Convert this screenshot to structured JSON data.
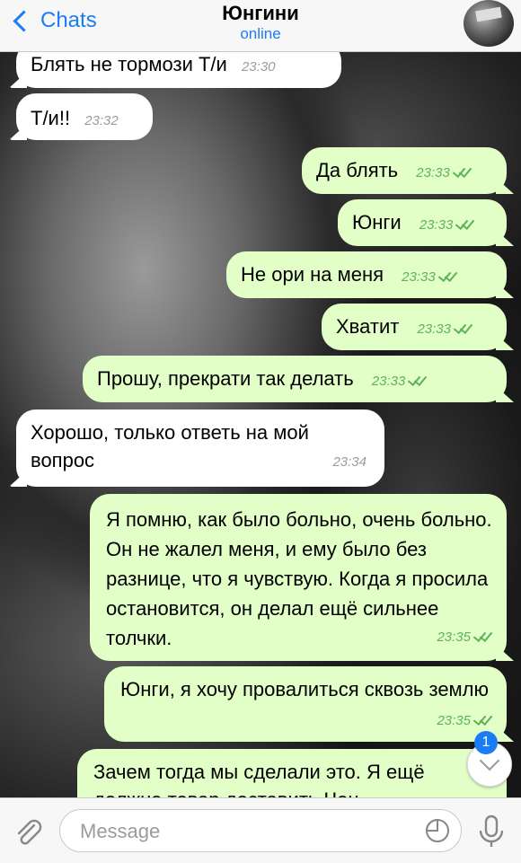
{
  "header": {
    "back_label": "Chats",
    "title": "Юнгини",
    "status": "online"
  },
  "messages": [
    {
      "dir": "in",
      "text": "Блять не тормози Т/и",
      "time": "23:30"
    },
    {
      "dir": "in",
      "text": "Т/и!!",
      "time": "23:32"
    },
    {
      "dir": "out",
      "text": "Да блять",
      "time": "23:33"
    },
    {
      "dir": "out",
      "text": "Юнги",
      "time": "23:33"
    },
    {
      "dir": "out",
      "text": "Не ори на меня",
      "time": "23:33"
    },
    {
      "dir": "out",
      "text": "Хватит",
      "time": "23:33"
    },
    {
      "dir": "out",
      "text": "Прошу, прекрати так делать",
      "time": "23:33"
    },
    {
      "dir": "in",
      "text": "Хорошо, только ответь на мой вопрос",
      "time": "23:34"
    },
    {
      "dir": "out",
      "text": "Я помню, как было больно, очень больно. Он не жалел меня, и ему было без разнице, что я чувствую. Когда я просила остановится, он делал ещё сильнее толчки.",
      "time": "23:35"
    },
    {
      "dir": "out",
      "text": "Юнги, я хочу провалиться сквозь землю",
      "time": "23:35"
    },
    {
      "dir": "out",
      "text": "Зачем тогда мы сделали это. Я ещё должна товар доставить Чон",
      "time": ""
    }
  ],
  "scroll_badge": "1",
  "input": {
    "placeholder": "Message"
  },
  "colors": {
    "accent": "#1c7cf4",
    "outgoing_bubble": "#e1ffc7",
    "incoming_bubble": "#ffffff",
    "check": "#5fb25a"
  },
  "icons": [
    "back-chevron-icon",
    "attach-paperclip-icon",
    "sticker-icon",
    "microphone-icon",
    "chevron-down-icon",
    "double-check-icon"
  ]
}
